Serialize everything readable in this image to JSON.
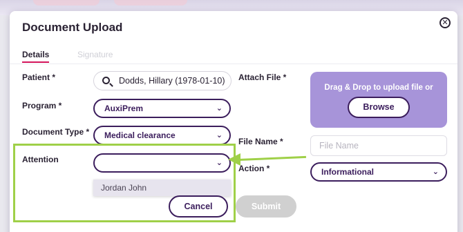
{
  "dialog": {
    "title": "Document Upload",
    "close_glyph": "✕"
  },
  "tabs": [
    {
      "label": "Details",
      "active": true
    },
    {
      "label": "Signature",
      "active": false
    }
  ],
  "form": {
    "patient_label": "Patient *",
    "patient_value": "Dodds, Hillary (1978-01-10)",
    "program_label": "Program *",
    "program_value": "AuxiPrem",
    "doctype_label": "Document Type *",
    "doctype_value": "Medical clearance",
    "attention_label": "Attention",
    "attention_value": "",
    "attention_options": [
      "Jordan John"
    ],
    "attach_label": "Attach File *",
    "dropzone_text": "Drag & Drop to upload file or",
    "browse_label": "Browse",
    "filename_label": "File Name *",
    "filename_placeholder": "File Name",
    "action_label": "Action *",
    "action_value": "Informational"
  },
  "buttons": {
    "cancel": "Cancel",
    "submit": "Submit"
  },
  "colors": {
    "accent": "#3b1d5c",
    "tab_underline": "#d4145a",
    "dropzone": "#a794d9",
    "annotation": "#9fd048",
    "disabled": "#d0d0d0"
  },
  "icons": {
    "search": "search-icon",
    "chevron": "chevron-down-icon",
    "close": "close-icon"
  }
}
